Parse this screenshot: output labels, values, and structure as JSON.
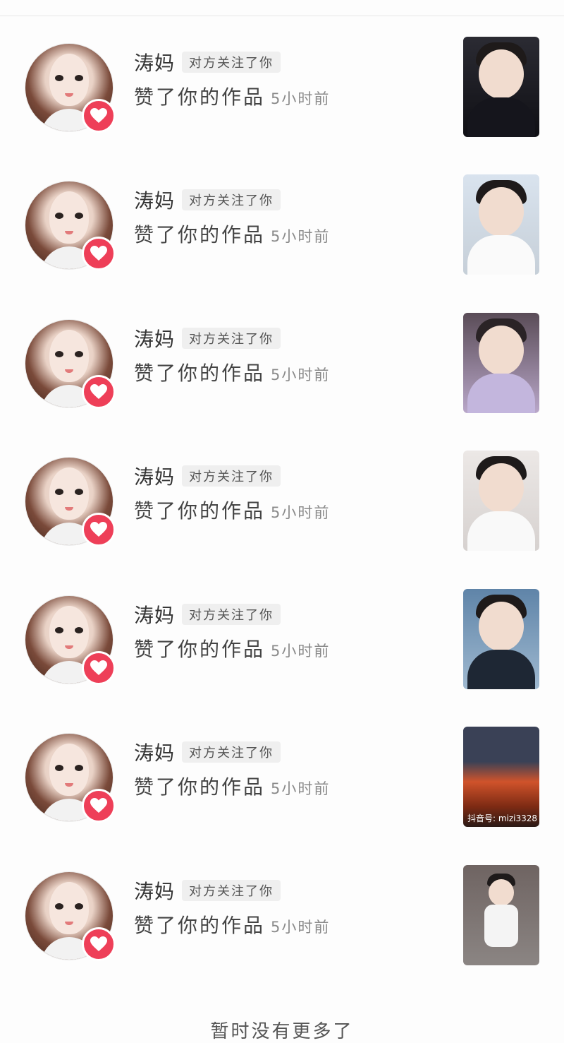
{
  "notifications": [
    {
      "name": "涛妈",
      "tag": "对方关注了你",
      "action": "赞了你的作品",
      "time": "5小时前",
      "icon": "heart-icon"
    },
    {
      "name": "涛妈",
      "tag": "对方关注了你",
      "action": "赞了你的作品",
      "time": "5小时前",
      "icon": "heart-icon"
    },
    {
      "name": "涛妈",
      "tag": "对方关注了你",
      "action": "赞了你的作品",
      "time": "5小时前",
      "icon": "heart-icon"
    },
    {
      "name": "涛妈",
      "tag": "对方关注了你",
      "action": "赞了你的作品",
      "time": "5小时前",
      "icon": "heart-icon"
    },
    {
      "name": "涛妈",
      "tag": "对方关注了你",
      "action": "赞了你的作品",
      "time": "5小时前",
      "icon": "heart-icon"
    },
    {
      "name": "涛妈",
      "tag": "对方关注了你",
      "action": "赞了你的作品",
      "time": "5小时前",
      "icon": "heart-icon",
      "thumb_watermark": "抖音号: mizi3328"
    },
    {
      "name": "涛妈",
      "tag": "对方关注了你",
      "action": "赞了你的作品",
      "time": "5小时前",
      "icon": "heart-icon"
    }
  ],
  "footer": {
    "text": "暂时没有更多了"
  },
  "colors": {
    "accent": "#ee3f58",
    "tag_bg": "#efefef",
    "time": "#8a8a8a"
  }
}
